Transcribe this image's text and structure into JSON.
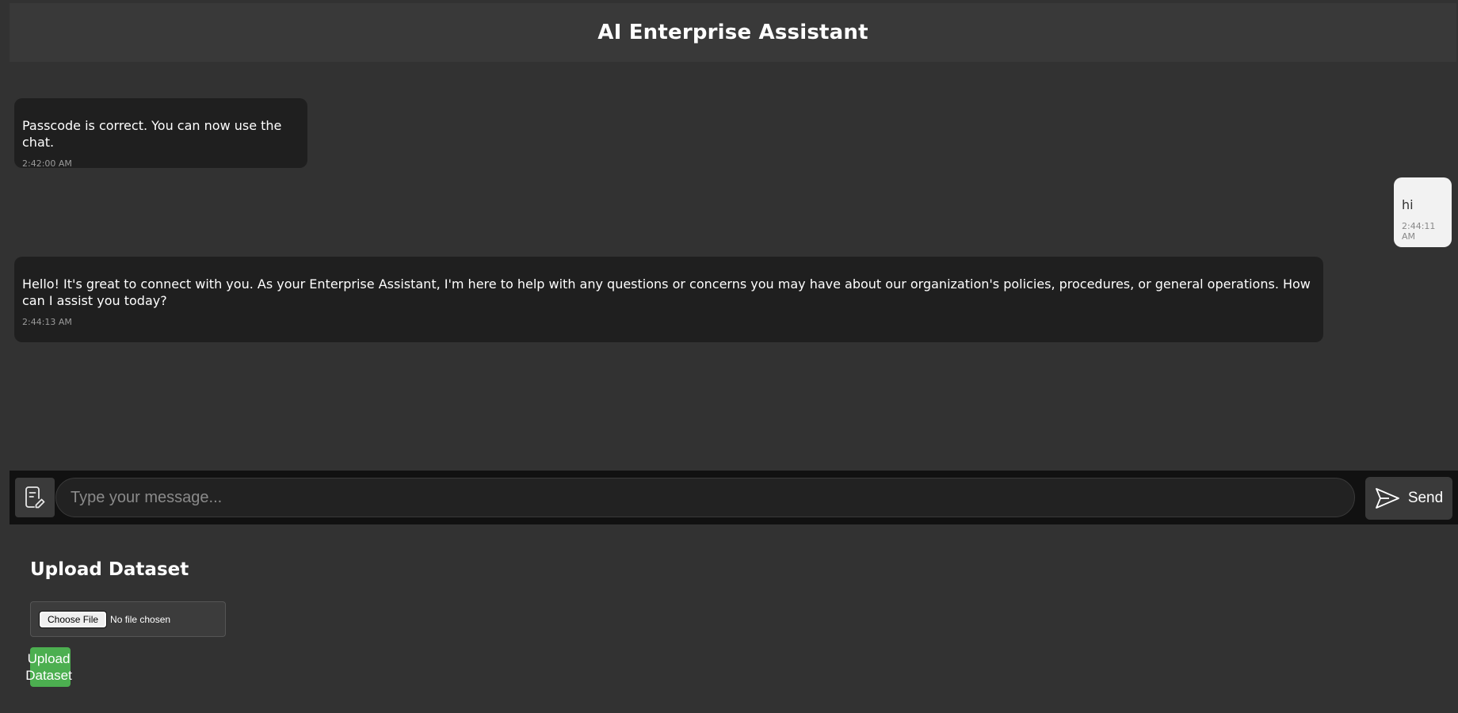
{
  "header": {
    "title": "AI Enterprise Assistant"
  },
  "messages": [
    {
      "sender": "bot",
      "text": "Passcode is correct. You can now use the chat.",
      "time": "2:42:00 AM"
    },
    {
      "sender": "user",
      "text": "hi",
      "time": "2:44:11 AM"
    },
    {
      "sender": "bot",
      "text": "Hello! It's great to connect with you. As your Enterprise Assistant, I'm here to help with any questions or concerns you may have about our organization's policies, procedures, or general operations. How can I assist you today?",
      "time": "2:44:13 AM"
    }
  ],
  "composer": {
    "placeholder": "Type your message...",
    "send_label": "Send",
    "attach_icon": "document-edit-icon",
    "send_icon": "paper-plane-icon"
  },
  "upload": {
    "title": "Upload Dataset",
    "choose_file_label": "Choose File",
    "no_file_text": "No file chosen",
    "button_label": "Upload Dataset"
  },
  "colors": {
    "background": "#323232",
    "header": "#393939",
    "bot_bubble": "#1f1f1f",
    "user_bubble": "#f2f2f2",
    "input_bar": "#111111",
    "upload_button": "#4caf50"
  }
}
